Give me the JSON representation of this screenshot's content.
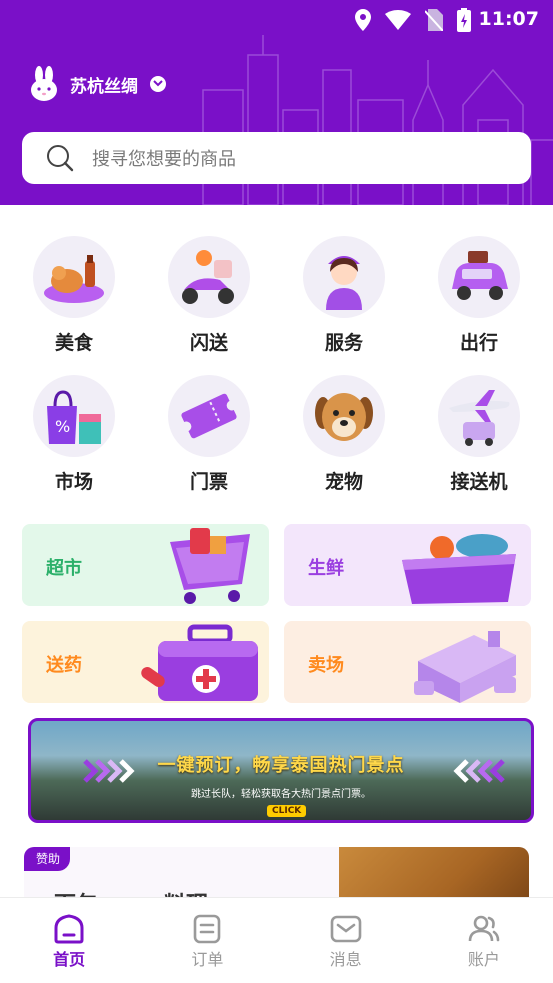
{
  "status_bar": {
    "time": "11:07"
  },
  "header": {
    "location": "苏杭丝绸",
    "search_placeholder": "搜寻您想要的商品"
  },
  "categories": [
    {
      "label": "美食",
      "icon": "food-icon"
    },
    {
      "label": "闪送",
      "icon": "courier-scooter-icon"
    },
    {
      "label": "服务",
      "icon": "service-person-icon"
    },
    {
      "label": "出行",
      "icon": "car-icon"
    },
    {
      "label": "市场",
      "icon": "shopping-bag-icon"
    },
    {
      "label": "门票",
      "icon": "ticket-icon"
    },
    {
      "label": "宠物",
      "icon": "dog-icon"
    },
    {
      "label": "接送机",
      "icon": "airplane-icon"
    }
  ],
  "tiles": [
    {
      "label": "超市",
      "color": "#2bb06a",
      "bg": "#e3f8ea",
      "icon": "shopping-cart-icon"
    },
    {
      "label": "生鲜",
      "color": "#9a3ee0",
      "bg": "#f3e6fb",
      "icon": "fresh-food-basket-icon"
    },
    {
      "label": "送药",
      "color": "#ff8a1e",
      "bg": "#fdf3dc",
      "icon": "medicine-box-icon"
    },
    {
      "label": "卖场",
      "color": "#ff8a1e",
      "bg": "#fdeee2",
      "icon": "mall-building-icon"
    }
  ],
  "banner": {
    "title": "一键预订，畅享泰国热门景点",
    "subtitle": "跳过长队，轻松获取各大热门景点门票。",
    "cta": "CLICK"
  },
  "sponsor": {
    "badge": "赞助",
    "title": "面包、……料理"
  },
  "bottom_nav": [
    {
      "label": "首页",
      "icon": "home-icon",
      "active": true
    },
    {
      "label": "订单",
      "icon": "orders-icon",
      "active": false
    },
    {
      "label": "消息",
      "icon": "message-icon",
      "active": false
    },
    {
      "label": "账户",
      "icon": "account-icon",
      "active": false
    }
  ],
  "colors": {
    "brand": "#7a10c8",
    "inactive": "#9a9a9a"
  }
}
